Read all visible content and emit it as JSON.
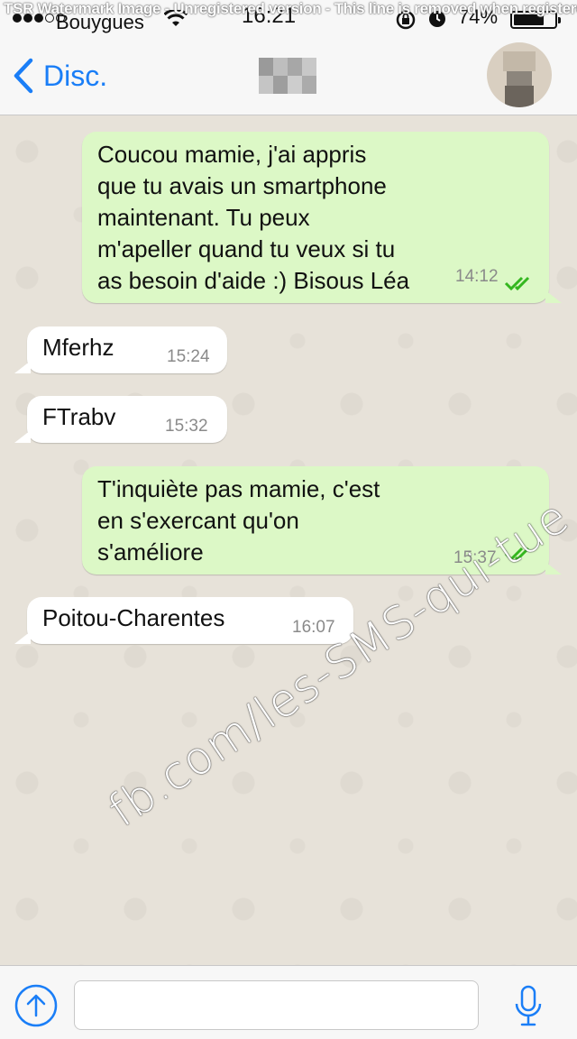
{
  "status_bar": {
    "watermark": "TSR Watermark Image - Unregistered version - This line is removed when registered",
    "carrier": "Bouygues",
    "time": "16:21",
    "battery_percent": "74%",
    "battery_level": 0.74
  },
  "nav": {
    "back_label": "Disc."
  },
  "messages": [
    {
      "direction": "out",
      "text": "Coucou mamie, j'ai appris\nque tu avais un smartphone\nmaintenant. Tu peux\nm'apeller quand tu veux si tu\nas besoin d'aide :) Bisous Léa",
      "time": "14:12"
    },
    {
      "direction": "in",
      "text": "Mferhz",
      "time": "15:24"
    },
    {
      "direction": "in",
      "text": "FTrabv",
      "time": "15:32"
    },
    {
      "direction": "out",
      "text": "T'inquiète pas mamie, c'est\nen s'exercant qu'on\ns'améliore",
      "time": "15:37"
    },
    {
      "direction": "in",
      "text": "Poitou-Charentes",
      "time": "16:07"
    }
  ],
  "overlay_watermark": "fb.com/les-SMS-qui-tue",
  "input": {
    "value": "",
    "placeholder": ""
  },
  "colors": {
    "accent": "#1a7ef7",
    "outgoing_bubble": "#dcf8c6",
    "incoming_bubble": "#ffffff",
    "read_ticks": "#34b71f"
  }
}
